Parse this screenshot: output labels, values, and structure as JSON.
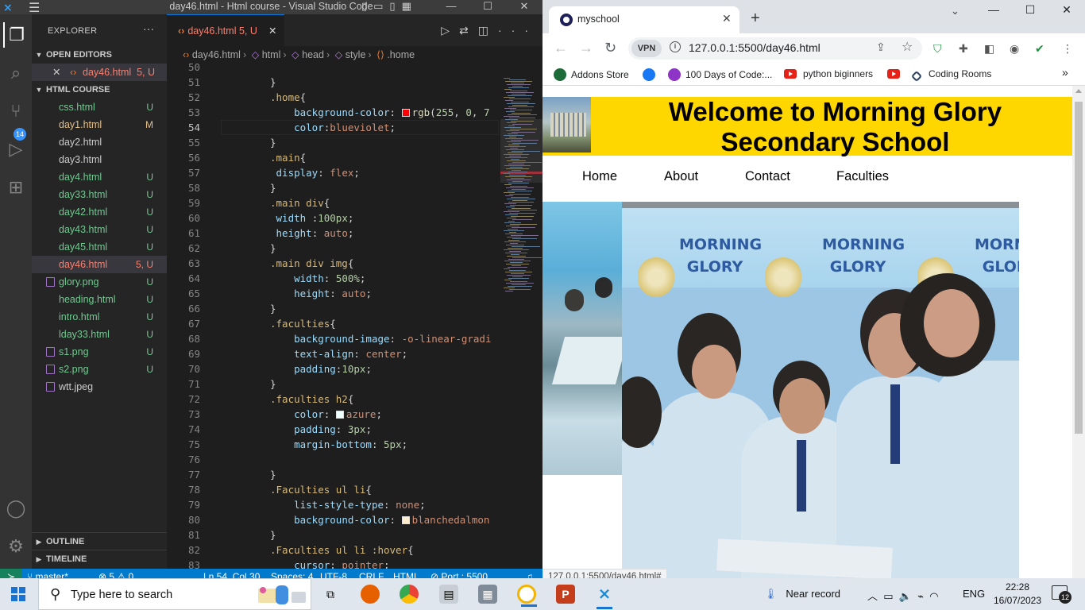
{
  "vscode": {
    "window_title": "day46.html - Html course - Visual Studio Code",
    "explorer": {
      "header": "EXPLORER",
      "open_editors_label": "OPEN EDITORS",
      "open_editor": {
        "name": "day46.html",
        "status": "5, U"
      },
      "folder_label": "HTML COURSE",
      "files": [
        {
          "name": "css.html",
          "status": "U"
        },
        {
          "name": "day1.html",
          "status": "M"
        },
        {
          "name": "day2.html",
          "status": ""
        },
        {
          "name": "day3.html",
          "status": ""
        },
        {
          "name": "day4.html",
          "status": "U"
        },
        {
          "name": "day33.html",
          "status": "U"
        },
        {
          "name": "day42.html",
          "status": "U"
        },
        {
          "name": "day43.html",
          "status": "U"
        },
        {
          "name": "day45.html",
          "status": "U"
        },
        {
          "name": "day46.html",
          "status": "5, U"
        },
        {
          "name": "glory.png",
          "status": "U"
        },
        {
          "name": "heading.html",
          "status": "U"
        },
        {
          "name": "intro.html",
          "status": "U"
        },
        {
          "name": "lday33.html",
          "status": "U"
        },
        {
          "name": "s1.png",
          "status": "U"
        },
        {
          "name": "s2.png",
          "status": "U"
        },
        {
          "name": "wtt.jpeg",
          "status": ""
        }
      ],
      "outline_label": "OUTLINE",
      "timeline_label": "TIMELINE"
    },
    "scm_badge": "14",
    "tab": {
      "name": "day46.html",
      "status": "5, U"
    },
    "breadcrumb": [
      "day46.html",
      "html",
      "head",
      "style",
      ".home"
    ],
    "lines": [
      {
        "n": "50",
        "text": ""
      },
      {
        "n": "51",
        "text": "}"
      },
      {
        "n": "52",
        "text": ".home{"
      },
      {
        "n": "53",
        "text": "    background-color: rgb(255, 0, 7"
      },
      {
        "n": "54",
        "text": "    color:blueviolet;"
      },
      {
        "n": "55",
        "text": "}"
      },
      {
        "n": "56",
        "text": ".main{"
      },
      {
        "n": "57",
        "text": " display: flex;"
      },
      {
        "n": "58",
        "text": "}"
      },
      {
        "n": "59",
        "text": ".main div{"
      },
      {
        "n": "60",
        "text": " width :100px;"
      },
      {
        "n": "61",
        "text": " height: auto;"
      },
      {
        "n": "62",
        "text": "}"
      },
      {
        "n": "63",
        "text": ".main div img{"
      },
      {
        "n": "64",
        "text": "    width: 500%;"
      },
      {
        "n": "65",
        "text": "    height: auto;"
      },
      {
        "n": "66",
        "text": "}"
      },
      {
        "n": "67",
        "text": ".faculties{"
      },
      {
        "n": "68",
        "text": "    background-image: -o-linear-gradi"
      },
      {
        "n": "69",
        "text": "    text-align: center;"
      },
      {
        "n": "70",
        "text": "    padding:10px;"
      },
      {
        "n": "71",
        "text": "}"
      },
      {
        "n": "72",
        "text": ".faculties h2{"
      },
      {
        "n": "73",
        "text": "    color: azure;"
      },
      {
        "n": "74",
        "text": "    padding: 3px;"
      },
      {
        "n": "75",
        "text": "    margin-bottom: 5px;"
      },
      {
        "n": "76",
        "text": ""
      },
      {
        "n": "77",
        "text": "}"
      },
      {
        "n": "78",
        "text": ".Faculties ul li{"
      },
      {
        "n": "79",
        "text": "    list-style-type: none;"
      },
      {
        "n": "80",
        "text": "    background-color: blanchedalmon"
      },
      {
        "n": "81",
        "text": "}"
      },
      {
        "n": "82",
        "text": ".Faculties ul li :hover{"
      },
      {
        "n": "83",
        "text": "    cursor: pointer;"
      }
    ],
    "status": {
      "branch": "master*",
      "problems": "5",
      "warnings": "0",
      "position": "Ln 54, Col 30",
      "spaces": "Spaces: 4",
      "encoding": "UTF-8",
      "eol": "CRLF",
      "language": "HTML",
      "port": "Port : 5500"
    }
  },
  "browser": {
    "tab_title": "myschool",
    "url": "127.0.0.1:5500/day46.html",
    "vpn_label": "VPN",
    "bookmarks": [
      "Addons Store",
      "100 Days of Code:...",
      "python biginners",
      "Coding Rooms"
    ],
    "status_url": "127.0.0.1:5500/day46.html#",
    "page": {
      "heading": "Welcome to Morning Glory Secondary School",
      "nav": [
        "Home",
        "About",
        "Contact",
        "Faculties"
      ],
      "banner_text": [
        "MORNING GLORY",
        "MORNING GLORY",
        "MORNING GLORY"
      ]
    },
    "colors": {
      "header_bg": "#ffd700"
    }
  },
  "taskbar": {
    "search_placeholder": "Type here to search",
    "weather": "Near record",
    "language": "ENG",
    "time": "22:28",
    "date": "16/07/2023",
    "notifications": "12"
  }
}
